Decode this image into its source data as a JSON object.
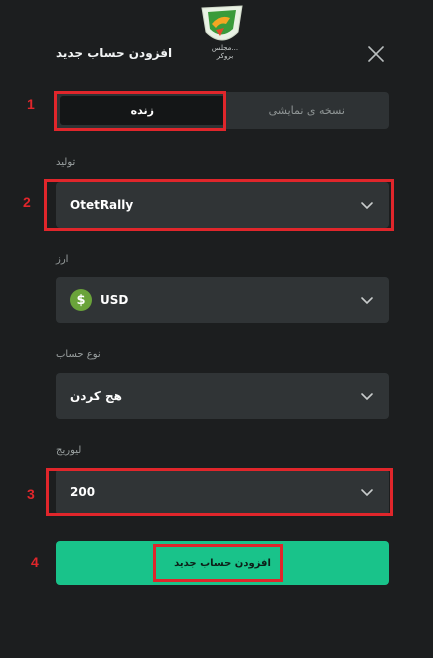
{
  "logo": {
    "text": "...مجلس بروکر"
  },
  "header": {
    "title": "افزودن حساب جدید"
  },
  "tabs": [
    {
      "label": "نسخه ی نمایشی"
    },
    {
      "label": "زنده"
    }
  ],
  "fields": {
    "platform": {
      "label": "تولید",
      "value": "OtetRally"
    },
    "currency": {
      "label": "ارز",
      "value": "USD",
      "icon": "dollar-icon",
      "icon_glyph": "$"
    },
    "account_type": {
      "label": "نوع حساب",
      "value": "هج کردن"
    },
    "leverage": {
      "label": "لیوریج",
      "value": "200"
    }
  },
  "submit": {
    "label": "افزودن حساب جدید"
  },
  "annotations": [
    "1",
    "2",
    "3",
    "4"
  ],
  "colors": {
    "background": "#1c1e1f",
    "field": "#303436",
    "accent": "#19c38a",
    "highlight": "#e0262b"
  }
}
